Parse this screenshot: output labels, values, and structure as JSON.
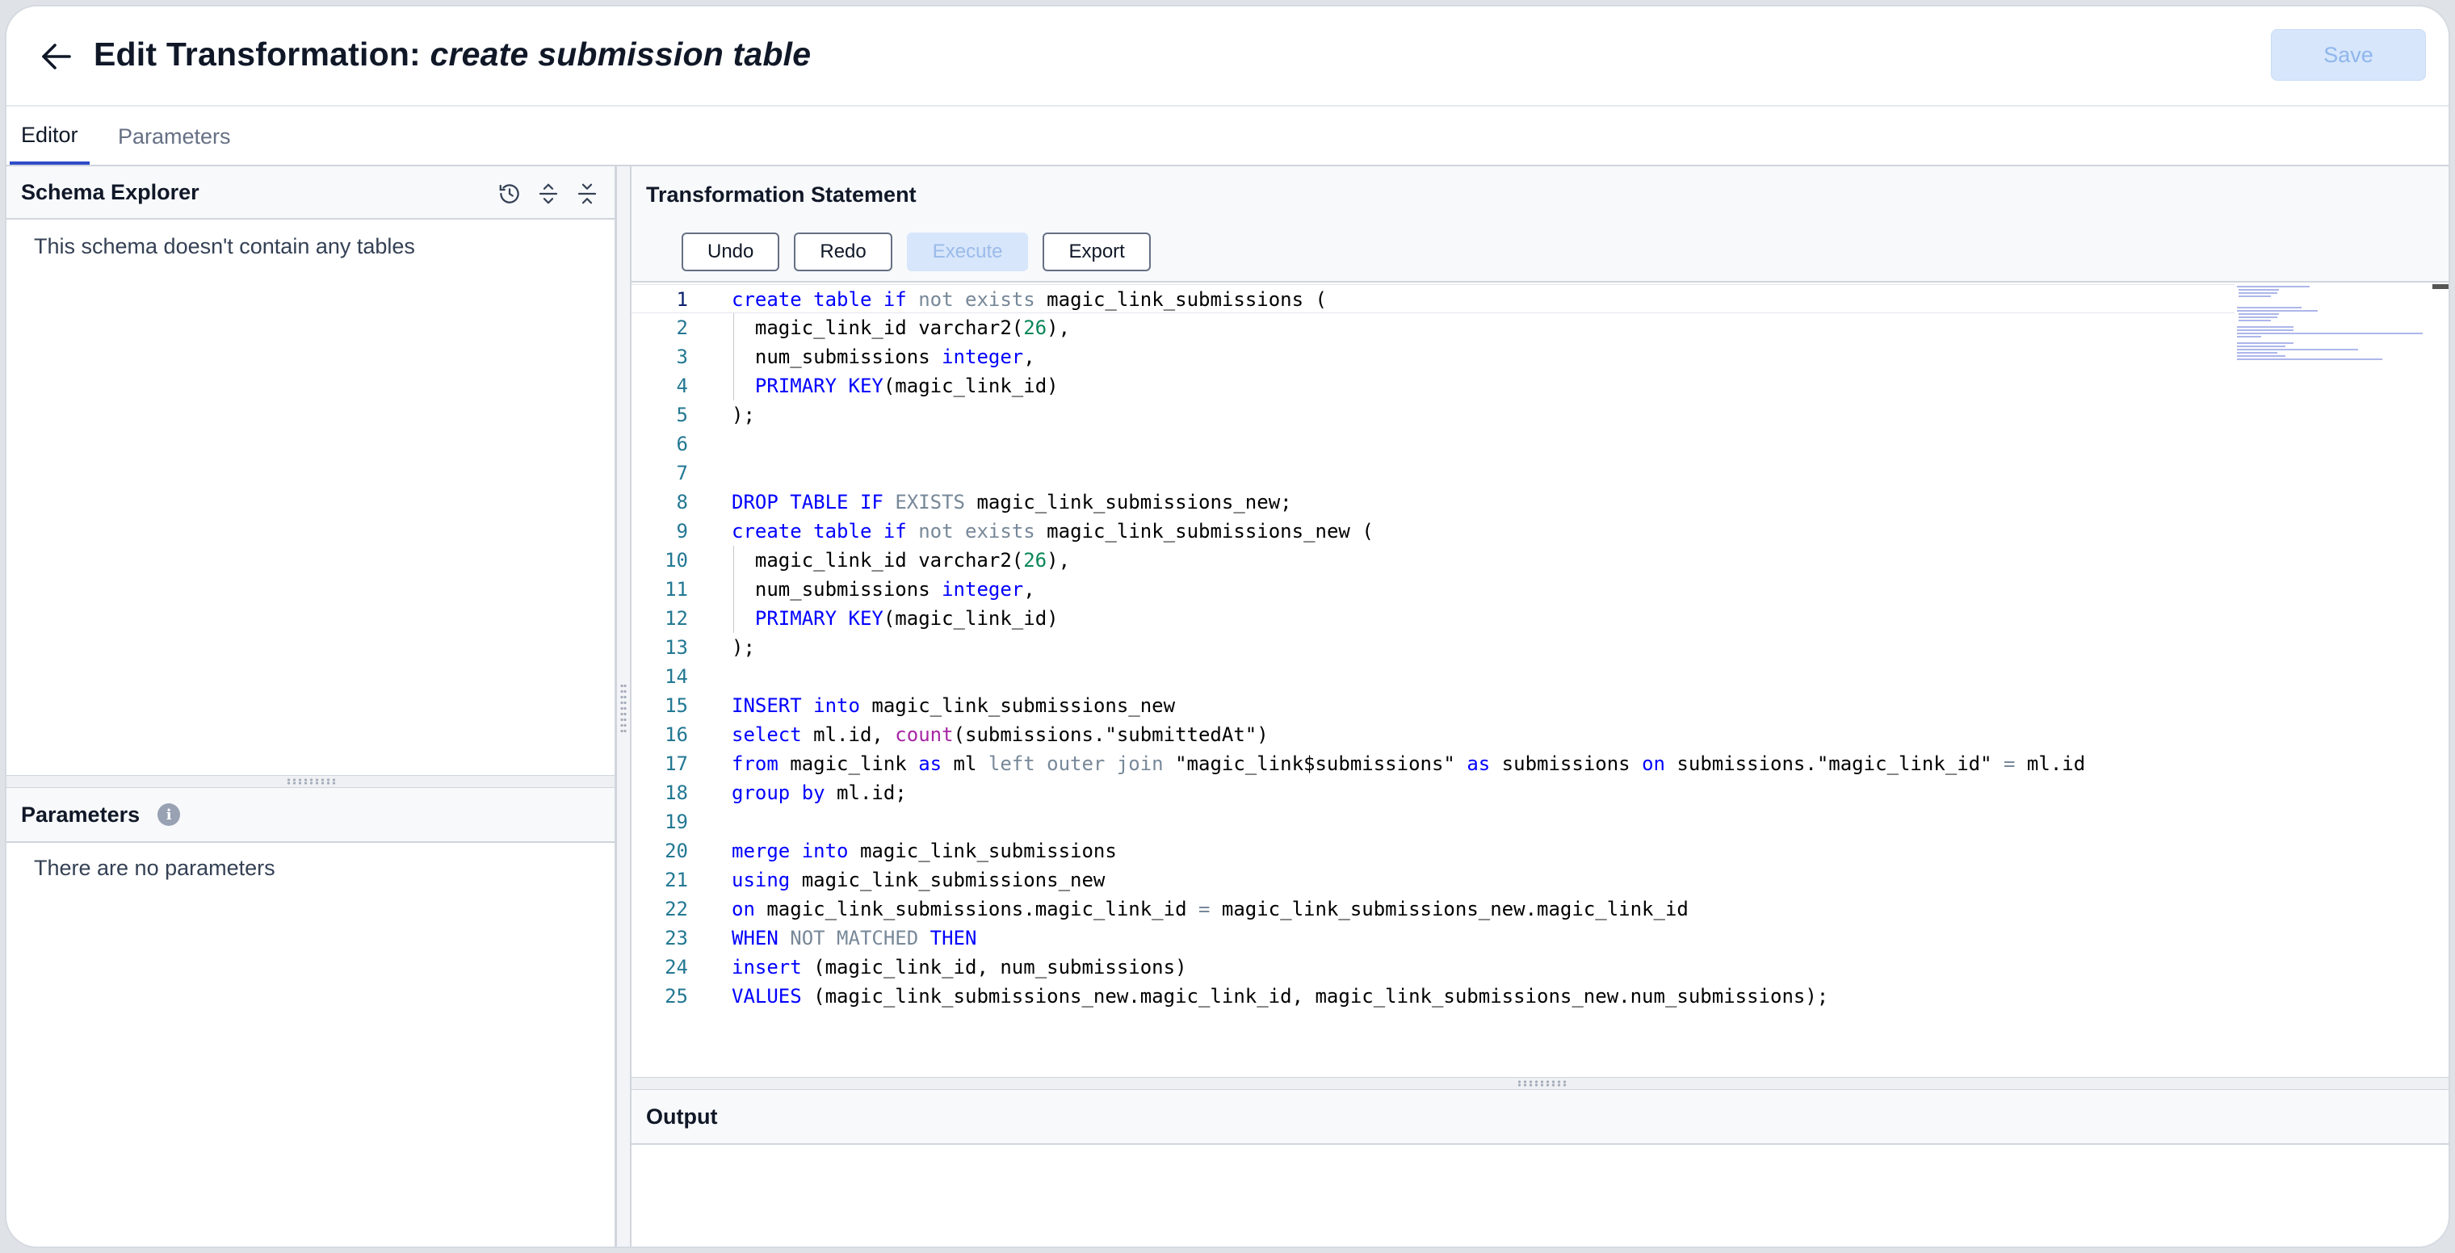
{
  "header": {
    "back_icon": "arrow-left-icon",
    "title_prefix": "Edit Transformation: ",
    "title_name": "create submission table",
    "save_label": "Save"
  },
  "tabs": [
    {
      "label": "Editor",
      "active": true
    },
    {
      "label": "Parameters",
      "active": false
    }
  ],
  "schema_explorer": {
    "title": "Schema Explorer",
    "icons": [
      "history-clock-icon",
      "expand-all-icon",
      "collapse-all-icon"
    ],
    "empty_message": "This schema doesn't contain any tables"
  },
  "parameters_panel": {
    "title": "Parameters",
    "info_icon": "info-icon",
    "empty_message": "There are no parameters"
  },
  "statement": {
    "title": "Transformation Statement",
    "toolbar": {
      "undo_label": "Undo",
      "redo_label": "Redo",
      "execute_label": "Execute",
      "export_label": "Export"
    },
    "current_line": 1,
    "lines": [
      [
        [
          "k",
          "create"
        ],
        [
          "t",
          " "
        ],
        [
          "k",
          "table"
        ],
        [
          "t",
          " "
        ],
        [
          "k",
          "if"
        ],
        [
          "t",
          " "
        ],
        [
          "g",
          "not"
        ],
        [
          "t",
          " "
        ],
        [
          "g",
          "exists"
        ],
        [
          "t",
          " magic_link_submissions ("
        ]
      ],
      [
        [
          "t",
          "  magic_link_id varchar2("
        ],
        [
          "n",
          "26"
        ],
        [
          "t",
          "),"
        ]
      ],
      [
        [
          "t",
          "  num_submissions "
        ],
        [
          "k",
          "integer"
        ],
        [
          "t",
          ","
        ]
      ],
      [
        [
          "t",
          "  "
        ],
        [
          "k",
          "PRIMARY KEY"
        ],
        [
          "t",
          "(magic_link_id)"
        ]
      ],
      [
        [
          "t",
          ");"
        ]
      ],
      [],
      [],
      [
        [
          "k",
          "DROP"
        ],
        [
          "t",
          " "
        ],
        [
          "k",
          "TABLE"
        ],
        [
          "t",
          " "
        ],
        [
          "k",
          "IF"
        ],
        [
          "t",
          " "
        ],
        [
          "g",
          "EXISTS"
        ],
        [
          "t",
          " magic_link_submissions_new;"
        ]
      ],
      [
        [
          "k",
          "create"
        ],
        [
          "t",
          " "
        ],
        [
          "k",
          "table"
        ],
        [
          "t",
          " "
        ],
        [
          "k",
          "if"
        ],
        [
          "t",
          " "
        ],
        [
          "g",
          "not"
        ],
        [
          "t",
          " "
        ],
        [
          "g",
          "exists"
        ],
        [
          "t",
          " magic_link_submissions_new ("
        ]
      ],
      [
        [
          "t",
          "  magic_link_id varchar2("
        ],
        [
          "n",
          "26"
        ],
        [
          "t",
          "),"
        ]
      ],
      [
        [
          "t",
          "  num_submissions "
        ],
        [
          "k",
          "integer"
        ],
        [
          "t",
          ","
        ]
      ],
      [
        [
          "t",
          "  "
        ],
        [
          "k",
          "PRIMARY KEY"
        ],
        [
          "t",
          "(magic_link_id)"
        ]
      ],
      [
        [
          "t",
          ");"
        ]
      ],
      [],
      [
        [
          "k",
          "INSERT"
        ],
        [
          "t",
          " "
        ],
        [
          "k",
          "into"
        ],
        [
          "t",
          " magic_link_submissions_new"
        ]
      ],
      [
        [
          "k",
          "select"
        ],
        [
          "t",
          " ml.id, "
        ],
        [
          "f",
          "count"
        ],
        [
          "t",
          "(submissions.\"submittedAt\")"
        ]
      ],
      [
        [
          "k",
          "from"
        ],
        [
          "t",
          " magic_link "
        ],
        [
          "k",
          "as"
        ],
        [
          "t",
          " ml "
        ],
        [
          "g",
          "left outer join"
        ],
        [
          "t",
          " \"magic_link$submissions\" "
        ],
        [
          "k",
          "as"
        ],
        [
          "t",
          " submissions "
        ],
        [
          "k",
          "on"
        ],
        [
          "t",
          " submissions.\"magic_link_id\" "
        ],
        [
          "g",
          "="
        ],
        [
          "t",
          " ml.id"
        ]
      ],
      [
        [
          "k",
          "group by"
        ],
        [
          "t",
          " ml.id;"
        ]
      ],
      [],
      [
        [
          "k",
          "merge"
        ],
        [
          "t",
          " "
        ],
        [
          "k",
          "into"
        ],
        [
          "t",
          " magic_link_submissions"
        ]
      ],
      [
        [
          "k",
          "using"
        ],
        [
          "t",
          " magic_link_submissions_new"
        ]
      ],
      [
        [
          "k",
          "on"
        ],
        [
          "t",
          " magic_link_submissions.magic_link_id "
        ],
        [
          "g",
          "="
        ],
        [
          "t",
          " magic_link_submissions_new.magic_link_id"
        ]
      ],
      [
        [
          "k",
          "WHEN"
        ],
        [
          "t",
          " "
        ],
        [
          "g",
          "NOT MATCHED"
        ],
        [
          "t",
          " "
        ],
        [
          "k",
          "THEN"
        ]
      ],
      [
        [
          "k",
          "insert"
        ],
        [
          "t",
          " (magic_link_id, num_submissions)"
        ]
      ],
      [
        [
          "k",
          "VALUES"
        ],
        [
          "t",
          " (magic_link_submissions_new.magic_link_id, magic_link_submissions_new.num_submissions);"
        ]
      ]
    ]
  },
  "output": {
    "title": "Output"
  },
  "colors": {
    "accent": "#2f4cc9",
    "keyword": "#0000ff",
    "operator": "#778899",
    "number": "#098658",
    "function": "#a626a4",
    "line_number": "#237893"
  }
}
